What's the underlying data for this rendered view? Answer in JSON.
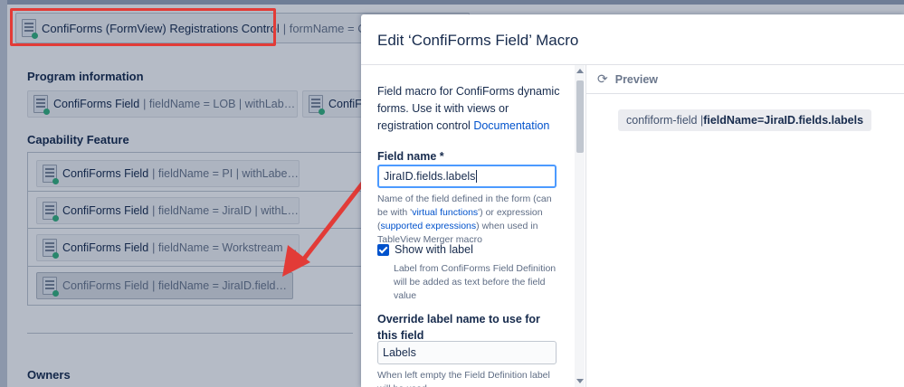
{
  "editor": {
    "registrations_macro": {
      "name": "ConfiForms (FormView) Registrations Control",
      "params": "| formName = Capabi"
    },
    "sections": {
      "program_information": "Program information",
      "capability_feature": "Capability Feature",
      "owners": "Owners"
    },
    "program_fields": [
      {
        "name": "ConfiForms Field",
        "params": "| fieldName = LOB | withLabel..."
      },
      {
        "name": "ConfiF",
        "params": ""
      }
    ],
    "capability_fields": [
      {
        "name": "ConfiForms Field",
        "params": "| fieldName = PI | withLabel ..."
      },
      {
        "name": "ConfiForms Field",
        "params": "| fieldName = JiraID | withLa..."
      },
      {
        "name": "ConfiForms Field",
        "params": "| fieldName = Workstream | wi..."
      },
      {
        "name": "ConfiForms Field",
        "params": "| fieldName = JiraID.fields.l..."
      }
    ]
  },
  "dialog": {
    "title": "Edit ‘ConfiForms Field’ Macro",
    "description": "Field macro for ConfiForms dynamic forms. Use it with views or registration control",
    "documentation_link": "Documentation",
    "field_name": {
      "label": "Field name *",
      "value": "JiraID.fields.labels",
      "help_1": "Name of the field defined in the form (can be with '",
      "help_link_1": "virtual functions",
      "help_2": "') or expression (",
      "help_link_2": "supported expressions",
      "help_3": ") when used in TableView Merger macro"
    },
    "show_with_label": {
      "label": "Show with label",
      "checked": true,
      "help": "Label from ConfiForms Field Definition will be added as text before the field value"
    },
    "override_label": {
      "label": "Override label name to use for this field",
      "value": "Labels",
      "help": "When left empty the Field Definition label will be used"
    },
    "preview": {
      "title": "Preview",
      "refresh_icon": "refresh-icon",
      "pill_prefix": "confiform-field | ",
      "pill_key": "fieldName",
      "pill_eq": " = ",
      "pill_value": "JiraID.fields.labels"
    }
  },
  "colors": {
    "accent": "#0052cc",
    "highlight": "#e23b37",
    "focus": "#4c9aff"
  }
}
